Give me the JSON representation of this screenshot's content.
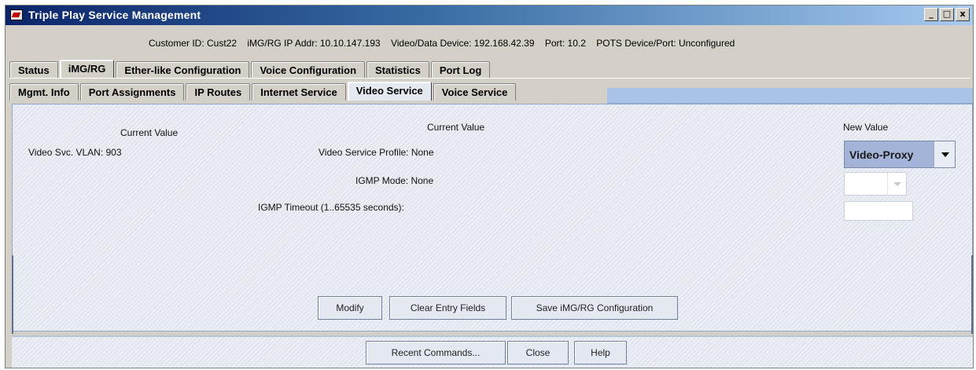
{
  "window": {
    "title": "Triple Play Service Management",
    "minimize": "_",
    "maximize": "□",
    "close": "x"
  },
  "info": {
    "customer_id": "Customer ID:  Cust22",
    "img_ip": "iMG/RG IP Addr:  10.10.147.193",
    "video_device": "Video/Data Device:  192.168.42.39",
    "port": "Port:  10.2",
    "pots": "POTS Device/Port:  Unconfigured"
  },
  "tabs_main": [
    {
      "label": "Status"
    },
    {
      "label": "iMG/RG"
    },
    {
      "label": "Ether-like Configuration"
    },
    {
      "label": "Voice Configuration"
    },
    {
      "label": "Statistics"
    },
    {
      "label": "Port Log"
    }
  ],
  "tabs_sub": [
    {
      "label": "Mgmt. Info"
    },
    {
      "label": "Port Assignments"
    },
    {
      "label": "IP Routes"
    },
    {
      "label": "Internet Service"
    },
    {
      "label": "Video Service"
    },
    {
      "label": "Voice Service"
    }
  ],
  "video": {
    "current_value_left": "Current Value",
    "current_value_mid": "Current Value",
    "new_value": "New Value",
    "vlan_label": "Video Svc. VLAN:  903",
    "profile_label": "Video Service Profile:  None",
    "igmp_mode_label": "IGMP Mode:  None",
    "igmp_timeout_label": "IGMP Timeout (1..65535 seconds):",
    "profile_select_value": "Video-Proxy",
    "igmp_mode_select_value": "",
    "igmp_timeout_value": ""
  },
  "actions": {
    "modify": "Modify",
    "clear": "Clear Entry Fields",
    "save": "Save iMG/RG Configuration"
  },
  "footer": {
    "recent": "Recent Commands...",
    "close": "Close",
    "help": "Help"
  },
  "colors": {
    "titlebar_start": "#0a246a",
    "panel": "#e4e8f0",
    "dropdown_accent": "#a4b4d8"
  }
}
